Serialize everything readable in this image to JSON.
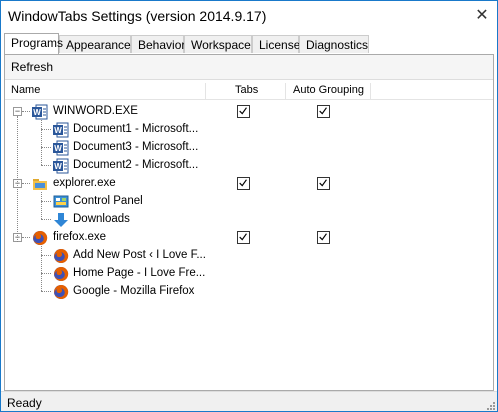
{
  "window": {
    "title": "WindowTabs Settings (version 2014.9.17)",
    "close_glyph": "✕"
  },
  "tabs": [
    "Programs",
    "Appearance",
    "Behavior",
    "Workspace",
    "License",
    "Diagnostics"
  ],
  "active_tab": "Programs",
  "toolbar": {
    "refresh_label": "Refresh"
  },
  "columns": {
    "name": "Name",
    "tabs": "Tabs",
    "auto_grouping": "Auto Grouping"
  },
  "programs": [
    {
      "name": "WINWORD.EXE",
      "icon": "word-icon",
      "tabs": true,
      "auto_grouping": true,
      "windows": [
        {
          "title": "Document1  -  Microsoft...",
          "icon": "word-icon"
        },
        {
          "title": "Document3  -  Microsoft...",
          "icon": "word-icon"
        },
        {
          "title": "Document2  -  Microsoft...",
          "icon": "word-icon"
        }
      ]
    },
    {
      "name": "explorer.exe",
      "icon": "folder-icon",
      "tabs": true,
      "auto_grouping": true,
      "windows": [
        {
          "title": "Control Panel",
          "icon": "control-panel-icon"
        },
        {
          "title": "Downloads",
          "icon": "download-arrow-icon"
        }
      ]
    },
    {
      "name": "firefox.exe",
      "icon": "firefox-icon",
      "tabs": true,
      "auto_grouping": true,
      "windows": [
        {
          "title": "Add New Post ‹ I Love F...",
          "icon": "firefox-icon"
        },
        {
          "title": "Home Page - I Love Fre...",
          "icon": "firefox-icon"
        },
        {
          "title": "Google - Mozilla Firefox",
          "icon": "firefox-icon"
        }
      ]
    }
  ],
  "status": {
    "text": "Ready"
  },
  "colors": {
    "window_border": "#1979ca",
    "word_blue": "#2b579a",
    "folder_yellow": "#f3c14b",
    "firefox_orange": "#e66000",
    "firefox_blue": "#3f51b5",
    "download_blue": "#2f86d6"
  }
}
